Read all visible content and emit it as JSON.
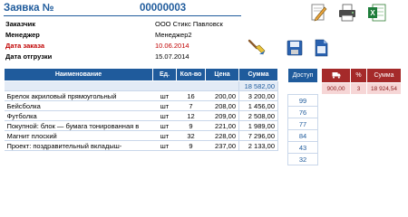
{
  "header": {
    "title": "Заявка №",
    "number": "00000003"
  },
  "info": {
    "customer_label": "Заказчик",
    "customer_value": "ООО Стикс Павловск",
    "manager_label": "Менеджер",
    "manager_value": "Менеджер2",
    "order_date_label": "Дата заказа",
    "order_date_value": "10.06.2014",
    "ship_date_label": "Дата отгрузки",
    "ship_date_value": "15.07.2014"
  },
  "toolbar": {
    "icons": [
      "edit-icon",
      "print-icon",
      "excel-icon",
      "brush-icon",
      "save-icon",
      "document-icon"
    ],
    "colors": {
      "header_blue": "#1f5b9c",
      "red_header": "#a52a2a",
      "red_cell": "#f6d6d6"
    }
  },
  "table": {
    "headers": [
      "Наименование",
      "Ед.",
      "Кол-во",
      "Цена",
      "Сумма"
    ],
    "total": "18 582,00",
    "rows": [
      {
        "name": "Брелок акриловый прямоугольный",
        "unit": "шт",
        "qty": "16",
        "price": "200,00",
        "sum": "3 200,00"
      },
      {
        "name": "Бейсболка",
        "unit": "шт",
        "qty": "7",
        "price": "208,00",
        "sum": "1 456,00"
      },
      {
        "name": "Футболка",
        "unit": "шт",
        "qty": "12",
        "price": "209,00",
        "sum": "2 508,00"
      },
      {
        "name": "Покупной: блок — бумага тонированная в",
        "unit": "шт",
        "qty": "9",
        "price": "221,00",
        "sum": "1 989,00"
      },
      {
        "name": "Магнит плоский",
        "unit": "шт",
        "qty": "32",
        "price": "228,00",
        "sum": "7 296,00"
      },
      {
        "name": "Проект: поздравительный вкладыш-",
        "unit": "шт",
        "qty": "9",
        "price": "237,00",
        "sum": "2 133,00"
      }
    ]
  },
  "access": {
    "header": "Доступ",
    "values": [
      "99",
      "76",
      "77",
      "84",
      "43",
      "32"
    ]
  },
  "summary": {
    "header_icon": "truck-icon",
    "headers": [
      "",
      "%",
      "Сумма"
    ],
    "values": [
      "900,00",
      "3",
      "18 924,54"
    ]
  }
}
